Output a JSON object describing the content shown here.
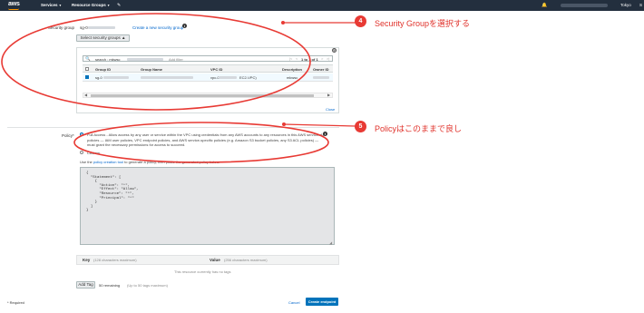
{
  "topbar": {
    "logo": "aws",
    "services": "Services",
    "resource_groups": "Resource Groups",
    "pin": "✎",
    "bell": "🔔",
    "region": "Tokyo",
    "support": "S"
  },
  "security_group": {
    "label": "Security group",
    "value": "sg-0",
    "create_link": "Create a new security group",
    "select_button": "Select security groups ▲"
  },
  "sg_panel": {
    "filter_value": "search : mkwsc",
    "filter_placeholder": "Add filter",
    "pagination": "1 to 1 of 1",
    "columns": [
      "Group ID",
      "Group Name",
      "VPC ID",
      "Description",
      "Owner ID"
    ],
    "row": {
      "group_id": "sg-0",
      "group_name": "",
      "vpc_id": "vpc-0",
      "vpc_suffix": "EC2-VPC)",
      "description": "mkwsc",
      "owner_id": ""
    },
    "close": "Close"
  },
  "policy": {
    "label": "Policy*",
    "full_access": "Full Access - Allow access by any user or service within the VPC using credentials from any AWS accounts to any resources in this AWS service. All policies — IAM user policies, VPC endpoint policies, and AWS service-specific policies (e.g. Amazon S3 bucket policies, any S3 ACL policies) — must grant the necessary permissions for access to succeed.",
    "custom": "Custom",
    "generator_pre": "Use the ",
    "generator_link": "policy creation tool",
    "generator_post": " to generate a policy, then paste the generated policy below.",
    "code": "{\n  \"Statement\": [\n    {\n      \"Action\": \"*\",\n      \"Effect\": \"Allow\",\n      \"Resource\": \"*\",\n      \"Principal\": \"*\"\n    }\n  ]\n}"
  },
  "tags": {
    "key_label": "Key",
    "key_placeholder": "(128 characters maximum)",
    "value_label": "Value",
    "value_placeholder": "(256 characters maximum)",
    "empty": "This resource currently has no tags",
    "add_tag": "Add Tag",
    "remaining": "50 remaining",
    "hint": "(Up to 50 tags maximum)"
  },
  "footer": {
    "required": "* Required",
    "cancel": "Cancel",
    "create": "Create endpoint"
  },
  "callouts": [
    {
      "number": "4",
      "text": "Security Groupを選択する"
    },
    {
      "number": "5",
      "text": "Policyはこのままで良し"
    }
  ],
  "colors": {
    "callout_red": "#e0322b",
    "aws_dark": "#232f3e",
    "aws_orange": "#ff9900",
    "primary_blue": "#0073bb"
  }
}
